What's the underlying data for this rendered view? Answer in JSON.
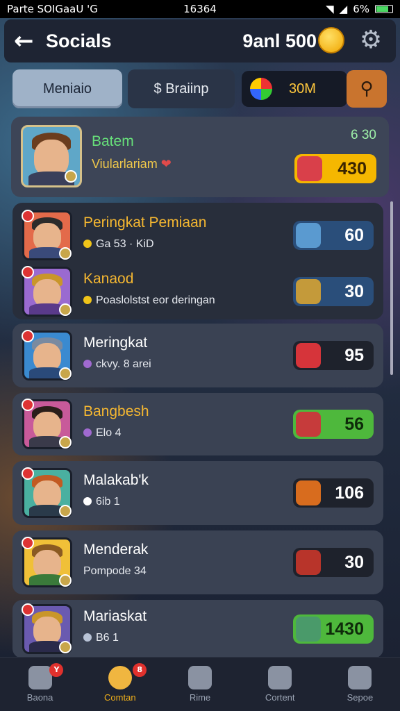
{
  "status_bar": {
    "carrier": "Parte SOIGaaU 'G",
    "time": "16364",
    "battery": "6%"
  },
  "header": {
    "title": "Socials",
    "coins": "9anl 500"
  },
  "tabs": [
    {
      "label": "Meniaio"
    },
    {
      "label": "$ Braiinp"
    }
  ],
  "currency": {
    "value": "30M"
  },
  "top_player": {
    "name": "Batem",
    "subtitle": "Viularlariam",
    "rank": "6 30",
    "score": "430"
  },
  "players": [
    {
      "name": "Peringkat Pemiaan",
      "sub": "Ga 53 · KiD",
      "score": "60",
      "name_color": "#f5b731",
      "pill": "pill-blue",
      "icon_color": "#5a9ad0",
      "dot": "#f0c419",
      "card": "dark"
    },
    {
      "name": "Kanaod",
      "sub": "Poaslolstst eor deringan",
      "score": "30",
      "name_color": "#f5b731",
      "pill": "pill-blue",
      "icon_color": "#c49a3a",
      "dot": "#f0c419",
      "card": "dark"
    },
    {
      "name": "Meringkat",
      "sub": "ckvy. 8 arei",
      "score": "95",
      "name_color": "#ffffff",
      "pill": "pill-dark",
      "icon_color": "#d6343a",
      "dot": "#a06ad0",
      "card": "light"
    },
    {
      "name": "Bangbesh",
      "sub": "Elo 4",
      "score": "56",
      "name_color": "#f5b731",
      "pill": "pill-green",
      "icon_color": "#c63b3b",
      "dot": "#a06ad0",
      "card": "light"
    },
    {
      "name": "Malakab'k",
      "sub": "6ib 1",
      "score": "106",
      "name_color": "#ffffff",
      "pill": "pill-dark",
      "icon_color": "#d86c1e",
      "dot": "#ffffff",
      "card": "light"
    },
    {
      "name": "Menderak",
      "sub": "Pompode 34",
      "score": "30",
      "name_color": "#ffffff",
      "pill": "pill-dark",
      "icon_color": "#b8342a",
      "dot": "",
      "card": "light"
    },
    {
      "name": "Mariaskat",
      "sub": "B6 1",
      "score": "1430",
      "name_color": "#ffffff",
      "pill": "pill-green",
      "icon_color": "#4a9a6a",
      "dot": "#b8c3d6",
      "card": "light"
    }
  ],
  "bottom_nav": [
    {
      "label": "Baona",
      "icon": "home-icon",
      "badge": "Y"
    },
    {
      "label": "Comtan",
      "icon": "friends-icon",
      "badge": "8"
    },
    {
      "label": "Rime",
      "icon": "timer-icon",
      "badge": ""
    },
    {
      "label": "Cortent",
      "icon": "inventory-icon",
      "badge": ""
    },
    {
      "label": "Sepoe",
      "icon": "profile-icon",
      "badge": ""
    }
  ]
}
